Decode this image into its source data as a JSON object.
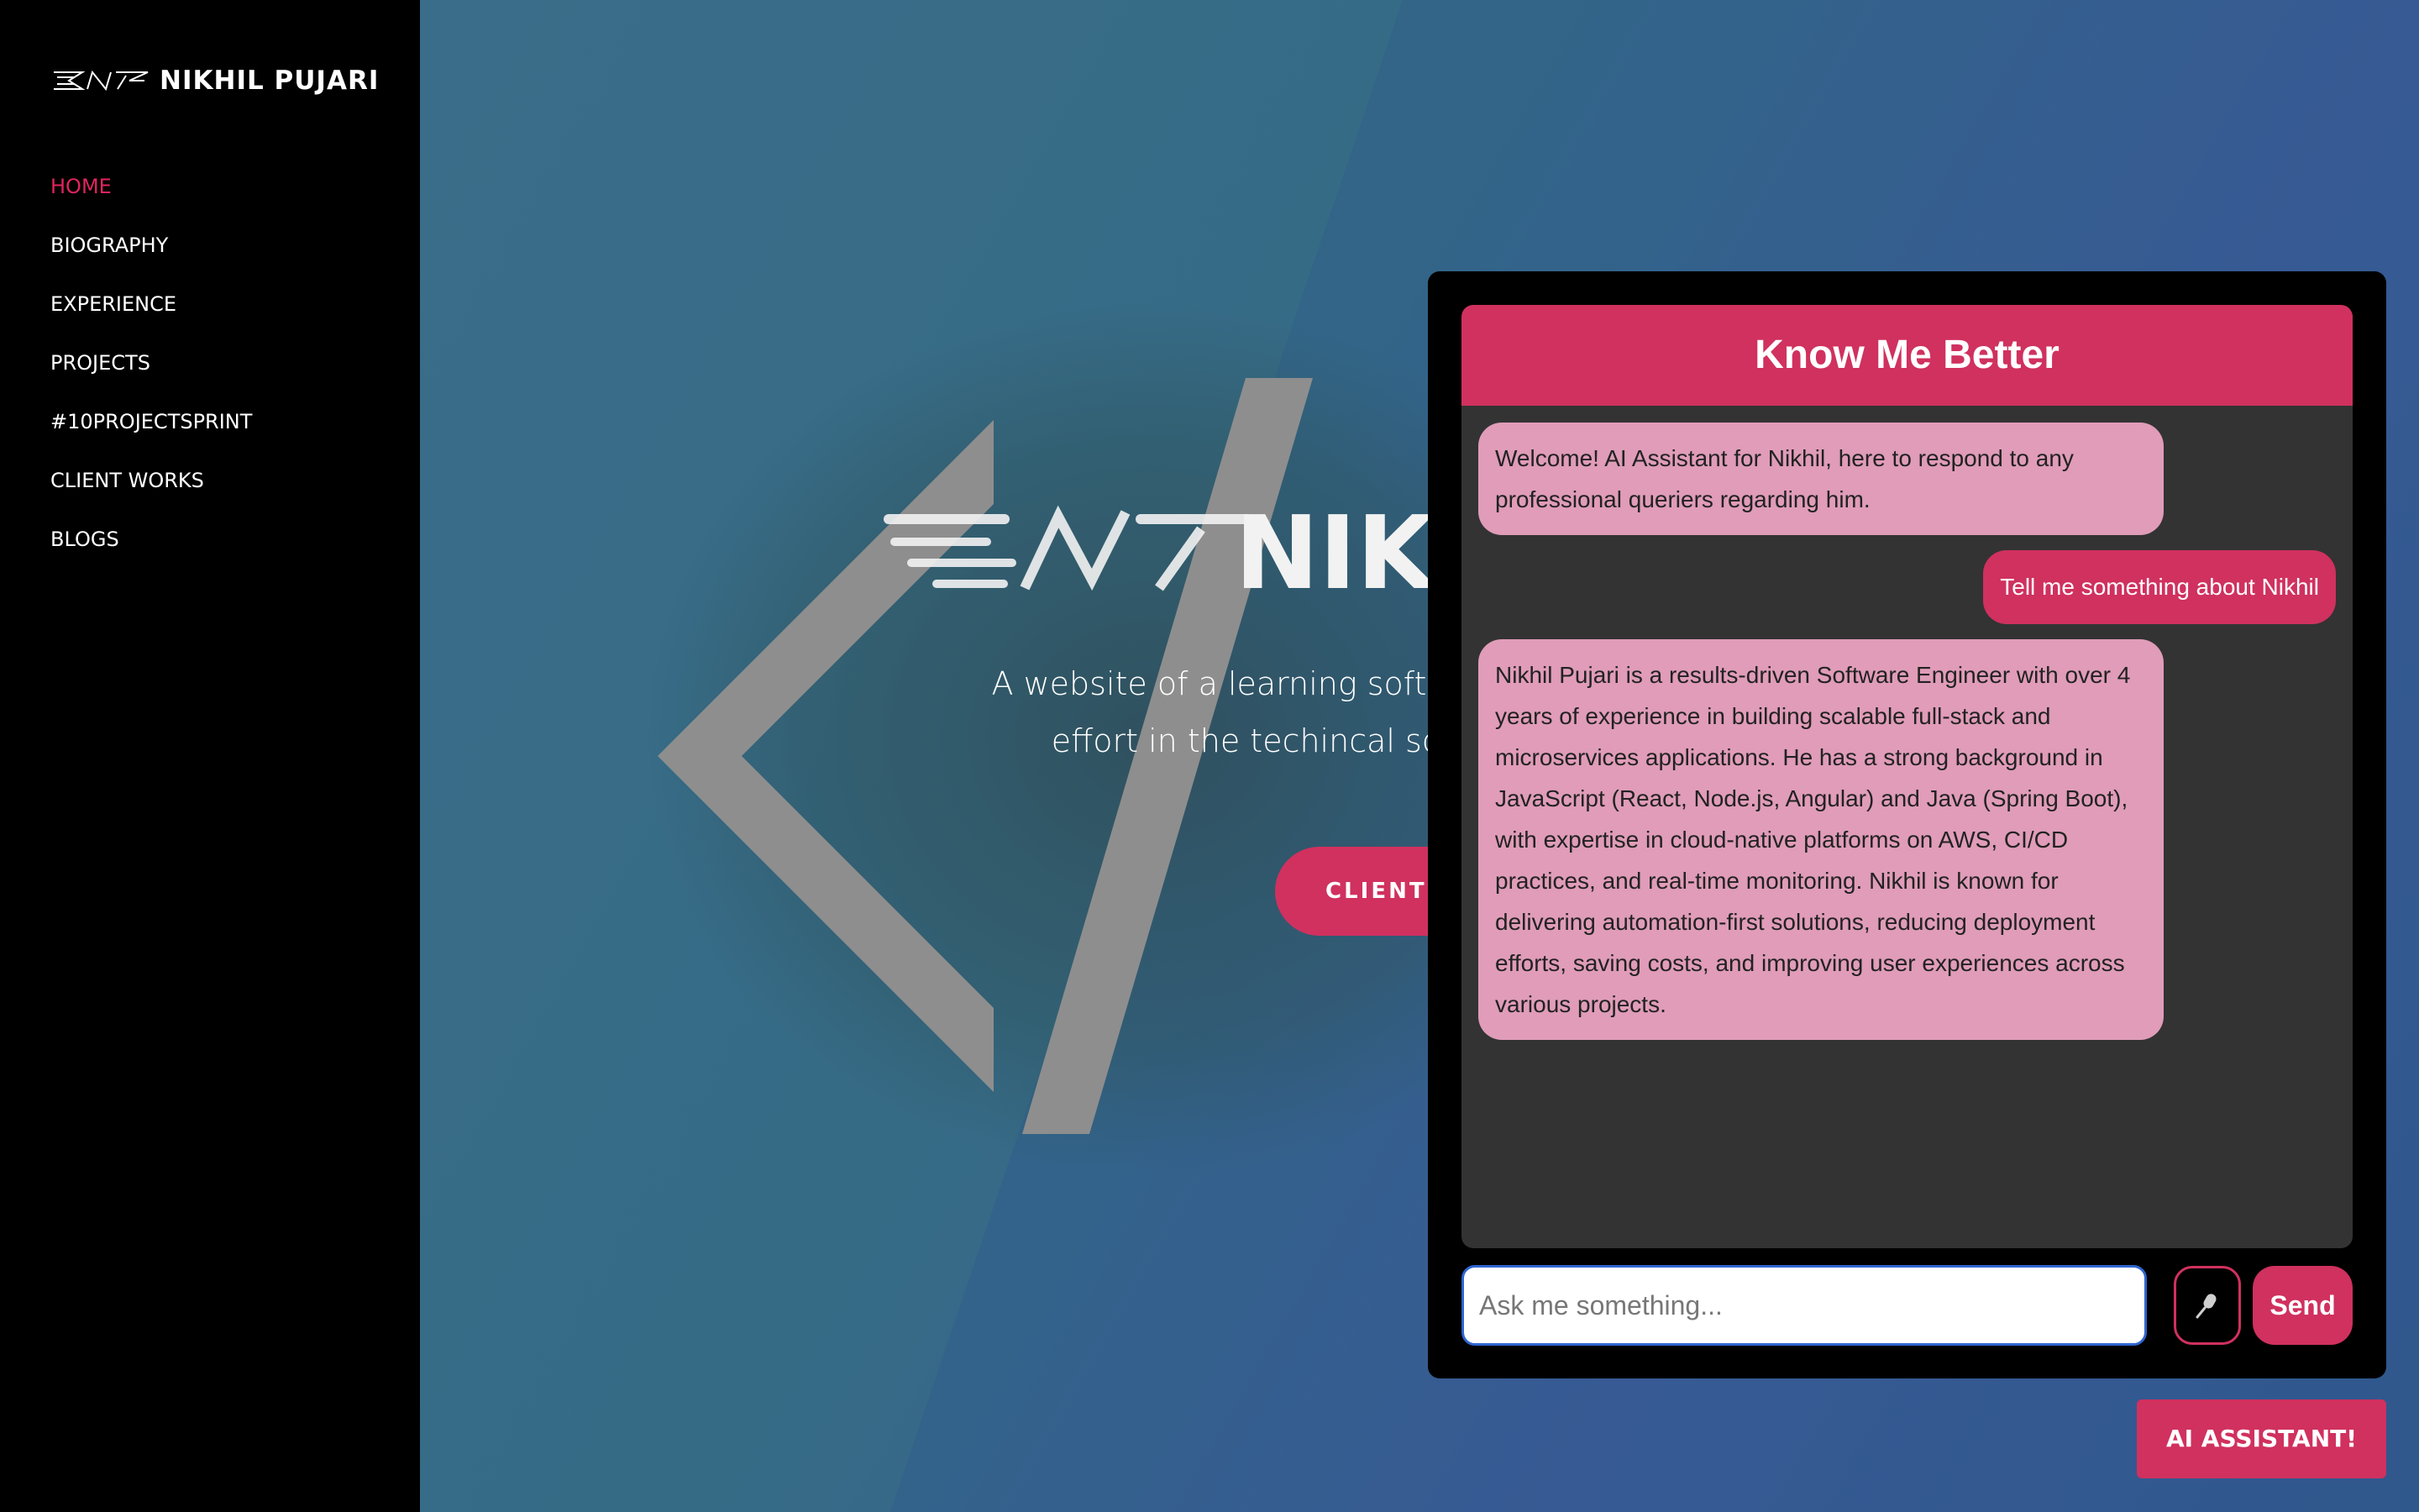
{
  "brand": {
    "name": "NIKHIL PUJARI",
    "logo_icon": "nikhil-wing-logo"
  },
  "nav": {
    "items": [
      {
        "label": "HOME",
        "active": true
      },
      {
        "label": "BIOGRAPHY",
        "active": false
      },
      {
        "label": "EXPERIENCE",
        "active": false
      },
      {
        "label": "PROJECTS",
        "active": false
      },
      {
        "label": "#10PROJECTSPRINT",
        "active": false
      },
      {
        "label": "CLIENT WORKS",
        "active": false
      },
      {
        "label": "BLOGS",
        "active": false
      }
    ]
  },
  "hero": {
    "title_partial": "NIKH",
    "tagline_line1": "A website of a learning software engir",
    "tagline_line2": "effort in the techincal society",
    "cta_label": "CLIENT"
  },
  "chat": {
    "title": "Know Me Better",
    "messages": [
      {
        "role": "bot",
        "text": "Welcome! AI Assistant for Nikhil, here to respond to any professional queriers regarding him."
      },
      {
        "role": "user",
        "text": "Tell me something about Nikhil"
      },
      {
        "role": "bot",
        "text": "Nikhil Pujari is a results-driven Software Engineer with over 4 years of experience in building scalable full-stack and microservices applications. He has a strong background in JavaScript (React, Node.js, Angular) and Java (Spring Boot), with expertise in cloud-native platforms on AWS, CI/CD practices, and real-time monitoring. Nikhil is known for delivering automation-first solutions, reducing deployment efforts, saving costs, and improving user experiences across various projects."
      }
    ],
    "input": {
      "placeholder": "Ask me something...",
      "value": ""
    },
    "mic_icon": "microphone-icon",
    "send_label": "Send"
  },
  "assistant_toggle_label": "AI ASSISTANT!",
  "colors": {
    "accent": "#d0315f",
    "bot_bubble": "#e09cb8",
    "chat_body": "#333333",
    "sidebar": "#000000"
  }
}
